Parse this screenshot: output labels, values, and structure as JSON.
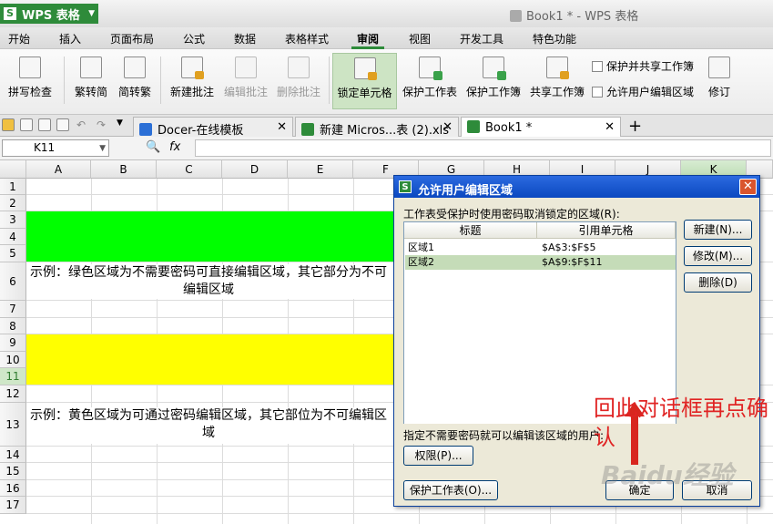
{
  "app": {
    "name": "WPS 表格",
    "window_title": "Book1 * - WPS 表格"
  },
  "menu": [
    "开始",
    "插入",
    "页面布局",
    "公式",
    "数据",
    "表格样式",
    "审阅",
    "视图",
    "开发工具",
    "特色功能"
  ],
  "ribbon": {
    "spell": "拼写检查",
    "trad": "繁转简",
    "simp": "简转繁",
    "new_comment": "新建批注",
    "edit_comment": "编辑批注",
    "delete_comment": "删除批注",
    "lock_cell": "锁定单元格",
    "protect_sheet": "保护工作表",
    "protect_book": "保护工作簿",
    "share_book": "共享工作簿",
    "protect_share": "保护并共享工作簿",
    "allow_edit": "允许用户编辑区域",
    "revise": "修订"
  },
  "tabs": [
    {
      "label": "Docer-在线模板",
      "color": "#2b6fd6"
    },
    {
      "label": "新建 Micros...表 (2).xls",
      "color": "#2e8b3a"
    },
    {
      "label": "Book1 *",
      "color": "#2e8b3a"
    }
  ],
  "formula": {
    "cell_ref": "K11",
    "fx": "fx",
    "content": ""
  },
  "columns": [
    "A",
    "B",
    "C",
    "D",
    "E",
    "F",
    "G",
    "H",
    "I",
    "J",
    "K"
  ],
  "rows": [
    "1",
    "2",
    "3",
    "4",
    "5",
    "6",
    "7",
    "8",
    "9",
    "10",
    "11",
    "12",
    "13",
    "14",
    "15",
    "16",
    "17"
  ],
  "cells": {
    "row6": "示例：绿色区域为不需要密码可直接编辑区域，其它部分为不可编辑区域",
    "row13": "示例：黄色区域为可通过密码编辑区域，其它部位为不可编辑区域"
  },
  "colors": {
    "green_fill": "#00ff00",
    "yellow_fill": "#ffff00",
    "accent": "#2e8b3a"
  },
  "dialog": {
    "title": "允许用户编辑区域",
    "caption": "工作表受保护时使用密码取消锁定的区域(R):",
    "col_title": "标题",
    "col_ref": "引用单元格",
    "ranges": [
      {
        "title": "区域1",
        "ref": "$A$3:$F$5"
      },
      {
        "title": "区域2",
        "ref": "$A$9:$F$11"
      }
    ],
    "btn_new": "新建(N)...",
    "btn_modify": "修改(M)...",
    "btn_delete": "删除(D)",
    "hint": "指定不需要密码就可以编辑该区域的用户:",
    "btn_perm": "权限(P)...",
    "btn_protect": "保护工作表(O)...",
    "btn_ok": "确定",
    "btn_cancel": "取消"
  },
  "annotation": "回此对话框再点确认",
  "watermark": "Baidu经验"
}
